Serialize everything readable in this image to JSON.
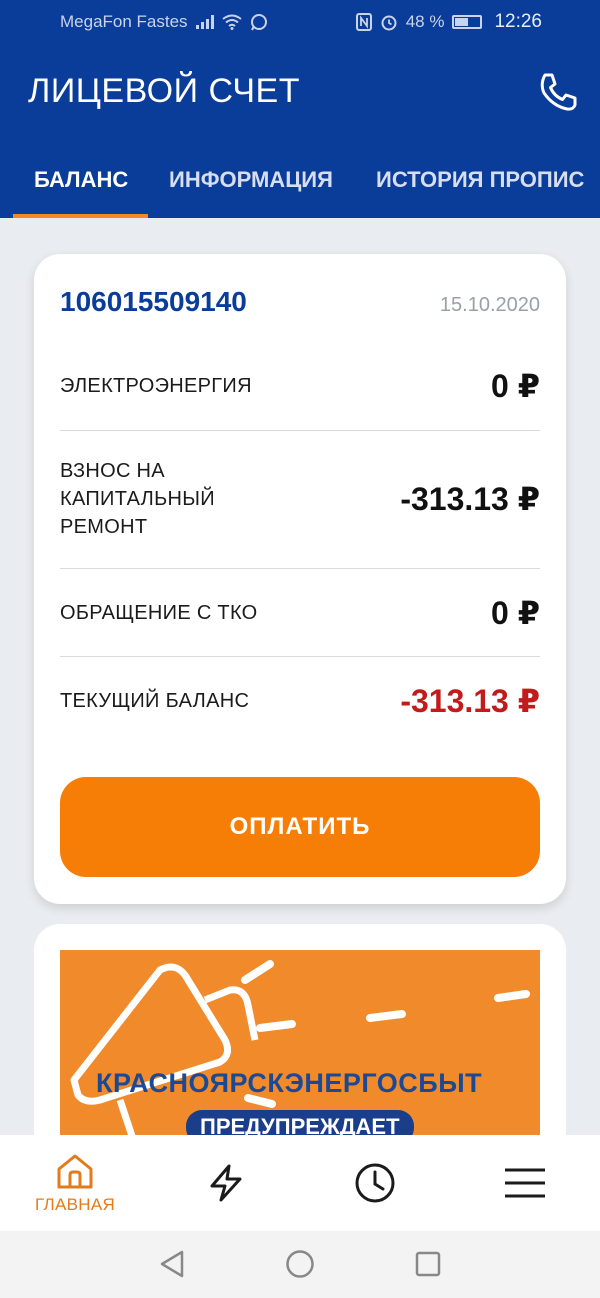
{
  "status_bar": {
    "carrier": "MegaFon Fastes",
    "battery": "48 %",
    "battery_level": 0.48,
    "time": "12:26",
    "icons": [
      "signal-icon",
      "wifi-icon",
      "whatsapp-icon",
      "nfc-icon",
      "alarm-icon",
      "battery-icon"
    ]
  },
  "header": {
    "title": "ЛИЦЕВОЙ СЧЕТ",
    "phone_icon": "phone-icon"
  },
  "tabs": [
    {
      "label": "БАЛАНС",
      "active": true
    },
    {
      "label": "ИНФОРМАЦИЯ",
      "active": false
    },
    {
      "label": "ИСТОРИЯ ПРОПИС",
      "active": false
    }
  ],
  "account": {
    "number": "106015509140",
    "date": "15.10.2020",
    "rows": [
      {
        "label": "ЭЛЕКТРОЭНЕРГИЯ",
        "value": "0 ₽",
        "negative": false
      },
      {
        "label": "ВЗНОС НА КАПИТАЛЬНЫЙ РЕМОНТ",
        "value": "-313.13 ₽",
        "negative": false
      },
      {
        "label": "ОБРАЩЕНИЕ С ТКО",
        "value": "0 ₽",
        "negative": false
      },
      {
        "label": "ТЕКУЩИЙ БАЛАНС",
        "value": "-313.13 ₽",
        "negative": true
      }
    ],
    "pay_button": "ОПЛАТИТЬ"
  },
  "promo": {
    "title": "КРАСНОЯРСКЭНЕРГОСБЫТ",
    "subtitle": "ПРЕДУПРЕЖДАЕТ"
  },
  "bottom_nav": [
    {
      "label": "ГЛАВНАЯ",
      "icon": "home-icon",
      "active": true
    },
    {
      "label": "",
      "icon": "lightning-icon",
      "active": false
    },
    {
      "label": "",
      "icon": "clock-icon",
      "active": false
    },
    {
      "label": "",
      "icon": "menu-icon",
      "active": false
    }
  ],
  "system_nav": [
    "back-icon",
    "home-circle-icon",
    "recents-icon"
  ],
  "colors": {
    "primary": "#0a3c9a",
    "accent": "#f67e07",
    "negative": "#c21b1b",
    "tab_indicator": "#f5872a"
  }
}
